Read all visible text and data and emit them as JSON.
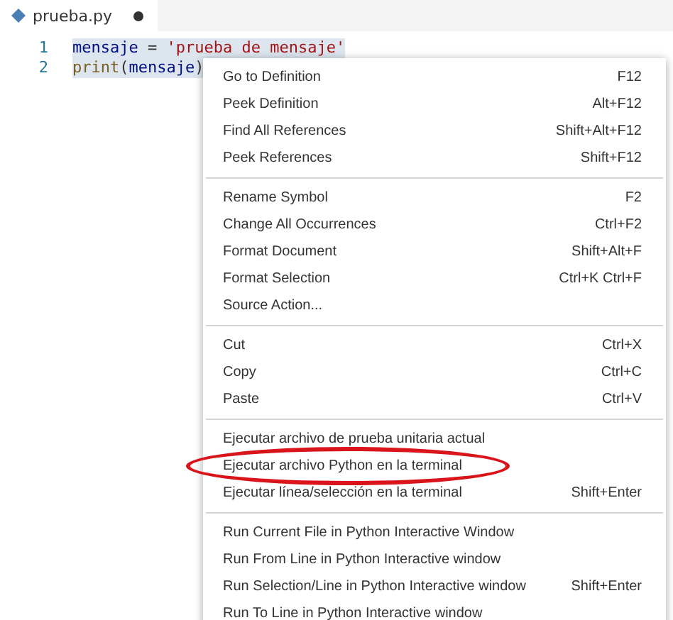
{
  "tab": {
    "title": "prueba.py",
    "dirty": true
  },
  "code": [
    {
      "number": "1",
      "tokens": [
        {
          "kind": "var",
          "text": "mensaje"
        },
        {
          "kind": "op",
          "text": " = "
        },
        {
          "kind": "str",
          "text": "'prueba de mensaje'"
        }
      ]
    },
    {
      "number": "2",
      "tokens": [
        {
          "kind": "fn",
          "text": "print"
        },
        {
          "kind": "op",
          "text": "("
        },
        {
          "kind": "var",
          "text": "mensaje"
        },
        {
          "kind": "op",
          "text": ")"
        }
      ]
    }
  ],
  "menu": [
    [
      {
        "label": "Go to Definition",
        "shortcut": "F12",
        "circled": false
      },
      {
        "label": "Peek Definition",
        "shortcut": "Alt+F12",
        "circled": false
      },
      {
        "label": "Find All References",
        "shortcut": "Shift+Alt+F12",
        "circled": false
      },
      {
        "label": "Peek References",
        "shortcut": "Shift+F12",
        "circled": false
      }
    ],
    [
      {
        "label": "Rename Symbol",
        "shortcut": "F2",
        "circled": false
      },
      {
        "label": "Change All Occurrences",
        "shortcut": "Ctrl+F2",
        "circled": false
      },
      {
        "label": "Format Document",
        "shortcut": "Shift+Alt+F",
        "circled": false
      },
      {
        "label": "Format Selection",
        "shortcut": "Ctrl+K Ctrl+F",
        "circled": false
      },
      {
        "label": "Source Action...",
        "circled": false
      }
    ],
    [
      {
        "label": "Cut",
        "shortcut": "Ctrl+X",
        "circled": false
      },
      {
        "label": "Copy",
        "shortcut": "Ctrl+C",
        "circled": false
      },
      {
        "label": "Paste",
        "shortcut": "Ctrl+V",
        "circled": false
      }
    ],
    [
      {
        "label": "Ejecutar archivo de prueba unitaria actual",
        "circled": false
      },
      {
        "label": "Ejecutar archivo Python en la terminal",
        "circled": true
      },
      {
        "label": "Ejecutar línea/selección en la terminal",
        "shortcut": "Shift+Enter",
        "circled": false
      }
    ],
    [
      {
        "label": "Run Current File in Python Interactive Window",
        "circled": false
      },
      {
        "label": "Run From Line in Python Interactive window",
        "circled": false
      },
      {
        "label": "Run Selection/Line in Python Interactive window",
        "shortcut": "Shift+Enter",
        "circled": false
      },
      {
        "label": "Run To Line in Python Interactive window",
        "circled": false
      }
    ]
  ]
}
